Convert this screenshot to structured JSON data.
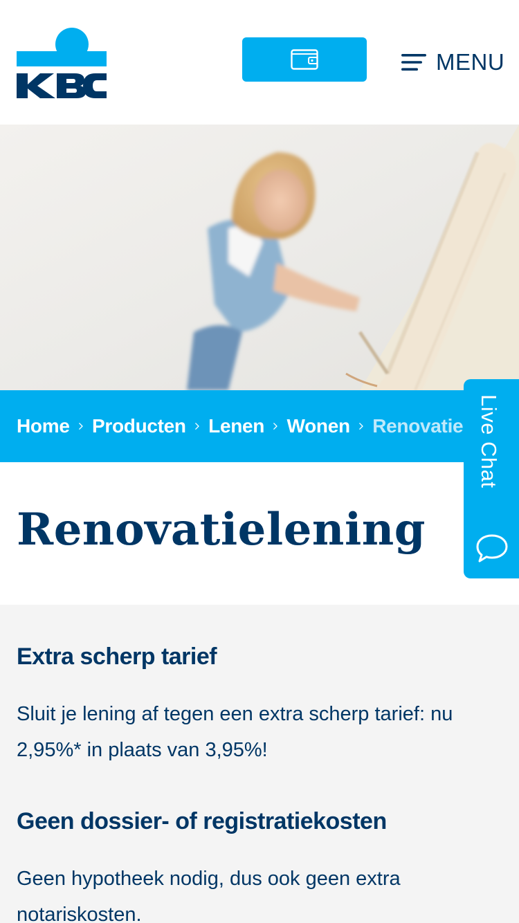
{
  "header": {
    "logo_text": "KBC",
    "wallet_icon": "wallet-icon",
    "menu_icon": "hamburger-icon",
    "menu_label": "MENU"
  },
  "hero": {
    "image": "woman-painting-wall-with-roller"
  },
  "breadcrumb": {
    "items": [
      "Home",
      "Producten",
      "Lenen",
      "Wonen",
      "Renovatielening"
    ],
    "separator_icon": "chevron-right-icon"
  },
  "page": {
    "title": "Renovatielening"
  },
  "sections": [
    {
      "heading": "Extra scherp tarief",
      "body_line1": "Sluit je lening af tegen een extra scherp tarief: nu",
      "body_line2": "2,95%* in plaats van 3,95%!"
    },
    {
      "heading": "Geen dossier- of registratiekosten",
      "body_line1": "Geen hypotheek nodig, dus ook geen extra",
      "body_line2": "notariskosten."
    }
  ],
  "livechat": {
    "label": "Live Chat",
    "icon": "chat-bubble-icon"
  },
  "colors": {
    "brand_blue": "#00aeef",
    "navy": "#003665",
    "content_bg": "#f4f4f4"
  }
}
